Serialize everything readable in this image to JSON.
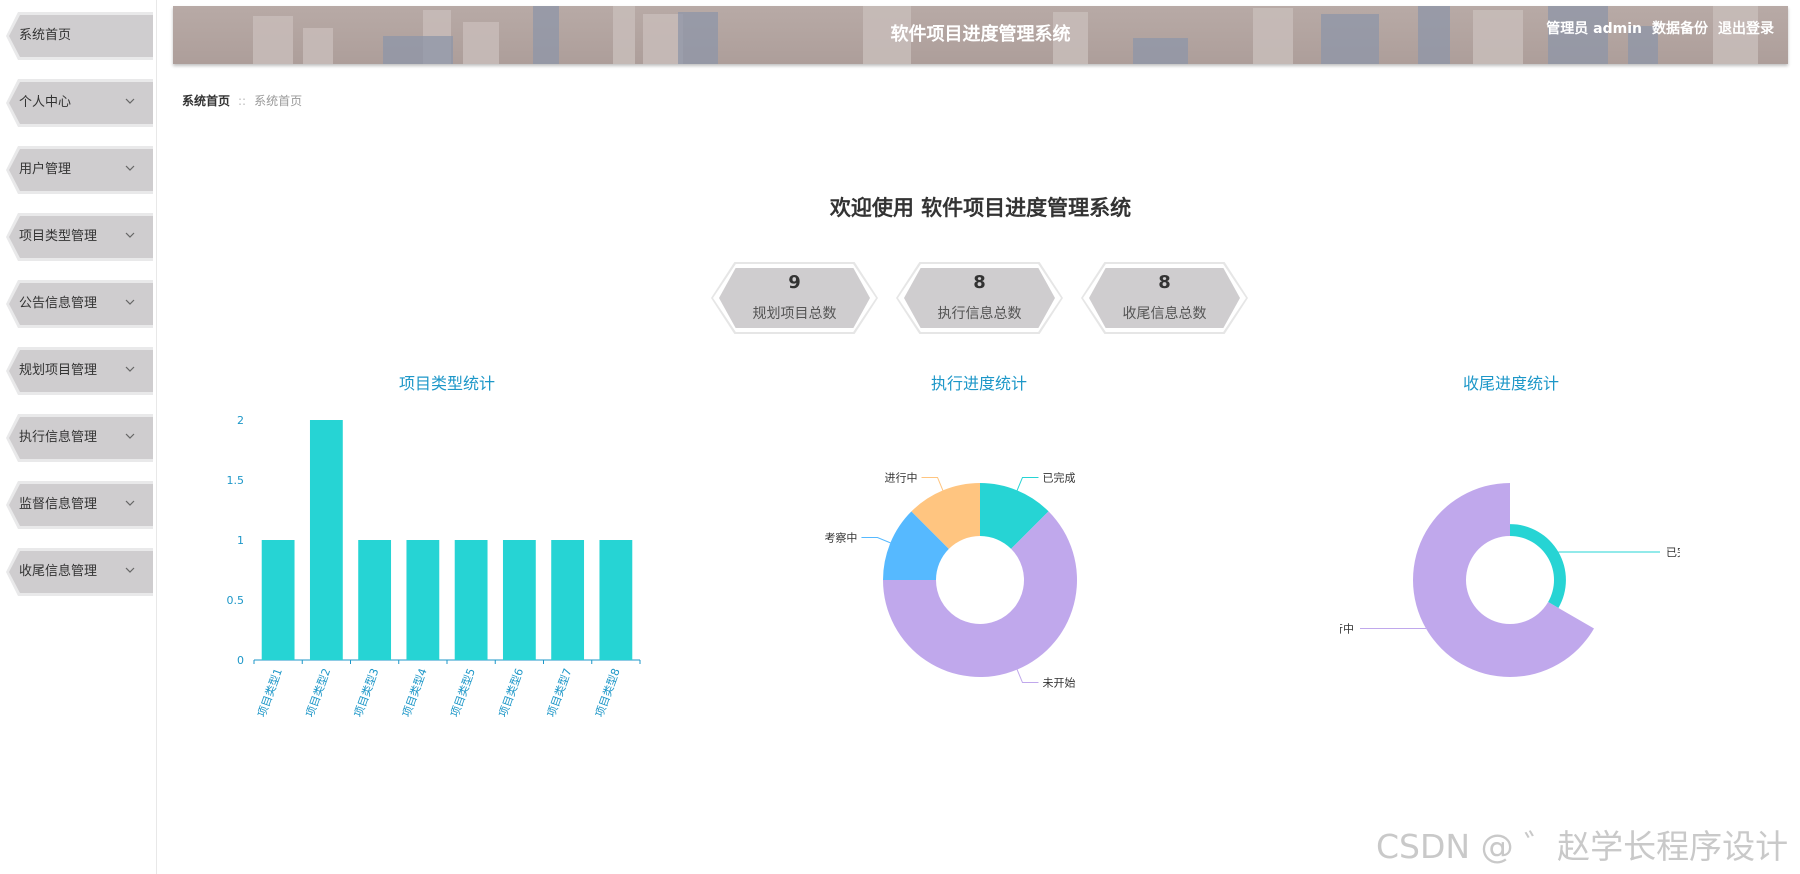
{
  "sidebar": {
    "items": [
      {
        "label": "系统首页",
        "has_chevron": false
      },
      {
        "label": "个人中心",
        "has_chevron": true
      },
      {
        "label": "用户管理",
        "has_chevron": true
      },
      {
        "label": "项目类型管理",
        "has_chevron": true
      },
      {
        "label": "公告信息管理",
        "has_chevron": true
      },
      {
        "label": "规划项目管理",
        "has_chevron": true
      },
      {
        "label": "执行信息管理",
        "has_chevron": true
      },
      {
        "label": "监督信息管理",
        "has_chevron": true
      },
      {
        "label": "收尾信息管理",
        "has_chevron": true
      }
    ]
  },
  "header": {
    "title": "软件项目进度管理系统",
    "user": "管理员 admin",
    "backup": "数据备份",
    "logout": "退出登录"
  },
  "breadcrumb": {
    "home": "系统首页",
    "separator": "::",
    "current": "系统首页"
  },
  "welcome": "欢迎使用 软件项目进度管理系统",
  "stats": [
    {
      "value": "9",
      "label": "规划项目总数"
    },
    {
      "value": "8",
      "label": "执行信息总数"
    },
    {
      "value": "8",
      "label": "收尾信息总数"
    }
  ],
  "chart_titles": {
    "bar": "项目类型统计",
    "exec": "执行进度统计",
    "finish": "收尾进度统计"
  },
  "chart_data": [
    {
      "type": "bar",
      "title": "项目类型统计",
      "categories": [
        "项目类型1",
        "项目类型2",
        "项目类型3",
        "项目类型4",
        "项目类型5",
        "项目类型6",
        "项目类型7",
        "项目类型8"
      ],
      "values": [
        1,
        2,
        1,
        1,
        1,
        1,
        1,
        1
      ],
      "ylim": [
        0,
        2
      ],
      "yticks": [
        "0",
        "0.5",
        "1",
        "1.5",
        "2"
      ],
      "color": "#26d4d4"
    },
    {
      "type": "pie",
      "style": "donut",
      "title": "执行进度统计",
      "slices": [
        {
          "name": "已完成",
          "value": 1,
          "color": "#26d4d4"
        },
        {
          "name": "未开始",
          "value": 5,
          "color": "#c0a8ec"
        },
        {
          "name": "考察中",
          "value": 1,
          "color": "#56b9ff"
        },
        {
          "name": "进行中",
          "value": 1,
          "color": "#ffc580"
        }
      ]
    },
    {
      "type": "pie",
      "style": "rose",
      "title": "收尾进度统计",
      "slices": [
        {
          "name": "已完成",
          "value": 1,
          "color": "#26d4d4"
        },
        {
          "name": "进行中",
          "value": 2,
          "color": "#c0a8ec"
        }
      ]
    }
  ],
  "watermark": "CSDN @ ゛赵学长程序设计",
  "colors": {
    "accent": "#1d97c8",
    "header_bg": "#b3a5a1",
    "menu_bg": "#cfcdcf"
  }
}
